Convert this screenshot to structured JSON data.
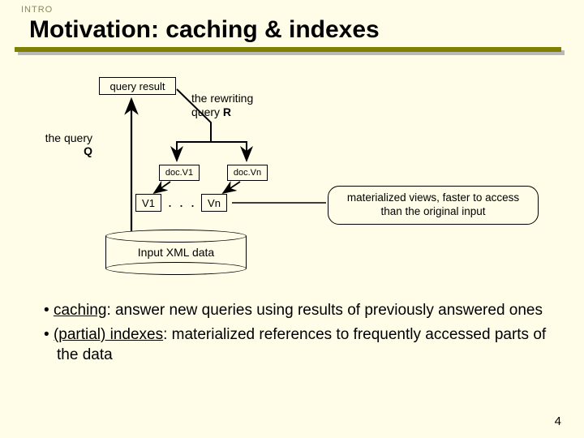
{
  "section": "INTRO",
  "title": "Motivation: caching & indexes",
  "diagram": {
    "query_result": "query result",
    "rewriting_line1": "the rewriting",
    "rewriting_line2_prefix": "query ",
    "rewriting_bold": "R",
    "the_query_line1": "the query",
    "the_query_bold": "Q",
    "docV1": "doc.V1",
    "docVn": "doc.Vn",
    "v1": "V1",
    "vn": "Vn",
    "ellipsis": ". . .",
    "callout": "materialized views, faster to access than the original input",
    "cylinder": "Input XML data"
  },
  "bullets": {
    "b1_under": "caching",
    "b1_rest": ": answer new queries using results of previously answered ones",
    "b2_under": "(partial) indexes",
    "b2_rest": ": materialized references to frequently accessed parts of the data"
  },
  "page": "4"
}
